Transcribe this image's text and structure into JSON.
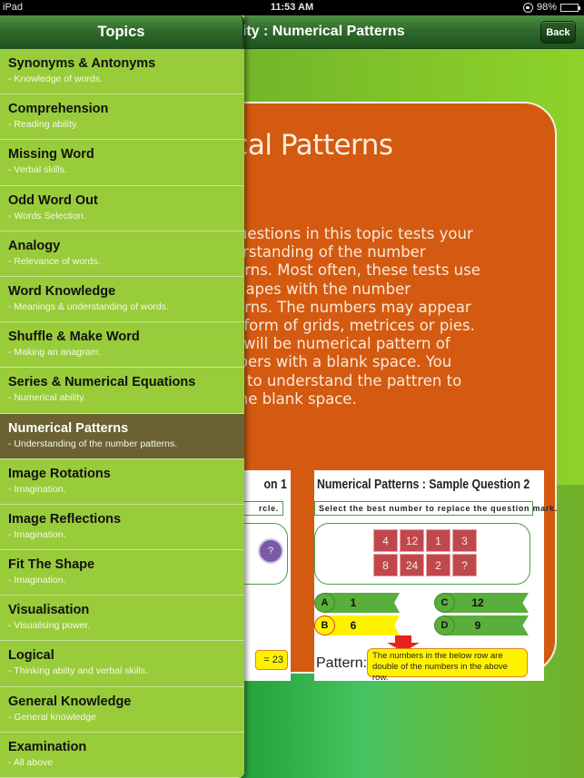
{
  "status_bar": {
    "device": "iPad",
    "time": "11:53 AM",
    "battery": "98%",
    "battery_level": 0.98
  },
  "nav_bar": {
    "title": "Mental Ability : Numerical Patterns",
    "visible_title": "ility : Numerical Patterns",
    "back_label": "Back"
  },
  "popover": {
    "title": "Topics",
    "selected_index": 8,
    "topics": [
      {
        "name": "Synonyms & Antonyms",
        "desc": "- Knowledge of words."
      },
      {
        "name": "Comprehension",
        "desc": "- Reading ability."
      },
      {
        "name": "Missing Word",
        "desc": "- Verbal skills."
      },
      {
        "name": "Odd Word Out",
        "desc": "- Words Selection."
      },
      {
        "name": "Analogy",
        "desc": "- Relevance of words."
      },
      {
        "name": "Word Knowledge",
        "desc": "- Meanings & understanding of words."
      },
      {
        "name": "Shuffle & Make Word",
        "desc": "- Making an anagram."
      },
      {
        "name": "Series & Numerical Equations",
        "desc": "- Numerical ability."
      },
      {
        "name": "Numerical Patterns",
        "desc": "- Understanding of the number patterns."
      },
      {
        "name": "Image Rotations",
        "desc": "- Imagination."
      },
      {
        "name": "Image Reflections",
        "desc": "- Imagination."
      },
      {
        "name": "Fit The Shape",
        "desc": "- Imagination."
      },
      {
        "name": "Visualisation",
        "desc": "- Visualising power."
      },
      {
        "name": "Logical",
        "desc": "- Thinking abilty and verbal skills."
      },
      {
        "name": "General Knowledge",
        "desc": "- General knowledge"
      },
      {
        "name": "Examination",
        "desc": "- All above"
      }
    ]
  },
  "card": {
    "title": "rical Patterns",
    "body_lines": [
      "e questions in this topic tests your",
      "nderstanding of the number",
      "atterns. Most often, these tests use",
      "e shapes with the number",
      "atterns. The numbers may appear",
      " the form of grids, metrices or pies.",
      "ere will be numerical pattern of",
      "umbers with  a blank space. You",
      "eed to understand the pattren to",
      " in the blank space."
    ]
  },
  "sample1": {
    "title": "on 1",
    "instruction": "rcle.",
    "bubble": "?",
    "equation": "= 23"
  },
  "sample2": {
    "title": "Numerical Patterns : Sample Question 2",
    "instruction": "Select the best number to replace the question mark.",
    "grid": [
      [
        "4",
        "12",
        "1",
        "3"
      ],
      [
        "8",
        "24",
        "2",
        "?"
      ]
    ],
    "options": [
      {
        "letter": "A",
        "value": "1"
      },
      {
        "letter": "B",
        "value": "6",
        "selected": true
      },
      {
        "letter": "C",
        "value": "12"
      },
      {
        "letter": "D",
        "value": "9"
      }
    ],
    "pattern_label": "Pattern:",
    "pattern_note": "The numbers in the below row are double of the numbers in the above row."
  },
  "colors": {
    "card_orange": "#d35a10",
    "topic_green": "#99cc3a",
    "topic_selected": "#6b6233",
    "nav_green": "#2f6a2a",
    "cell_red": "#c0484c",
    "option_green": "#5aae3c",
    "option_yellow": "#fff200"
  }
}
